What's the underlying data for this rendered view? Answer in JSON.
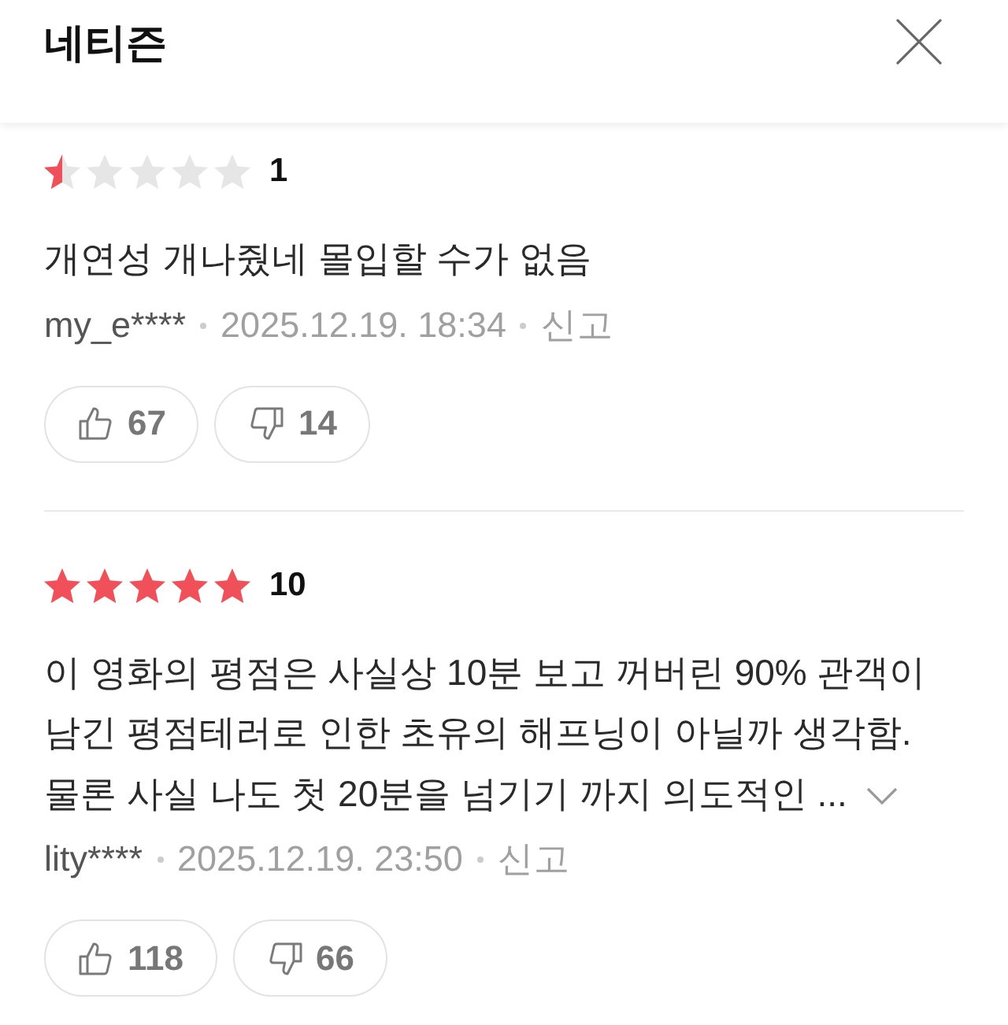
{
  "header": {
    "title": "네티즌"
  },
  "reviews": [
    {
      "stars": 0.5,
      "score": "1",
      "text": "개연성 개나줬네 몰입할 수가 없음",
      "truncated": false,
      "author": "my_e****",
      "date": "2025.12.19. 18:34",
      "report": "신고",
      "likes": "67",
      "dislikes": "14"
    },
    {
      "stars": 5,
      "score": "10",
      "text": "이 영화의 평점은 사실상 10분 보고 꺼버린 90% 관객이 남긴 평점테러로 인한 초유의 해프닝이 아닐까 생각함. 물론 사실 나도 첫 20분을 넘기기 까지 의도적인 ...",
      "truncated": true,
      "author": "lity****",
      "date": "2025.12.19. 23:50",
      "report": "신고",
      "likes": "118",
      "dislikes": "66"
    }
  ]
}
